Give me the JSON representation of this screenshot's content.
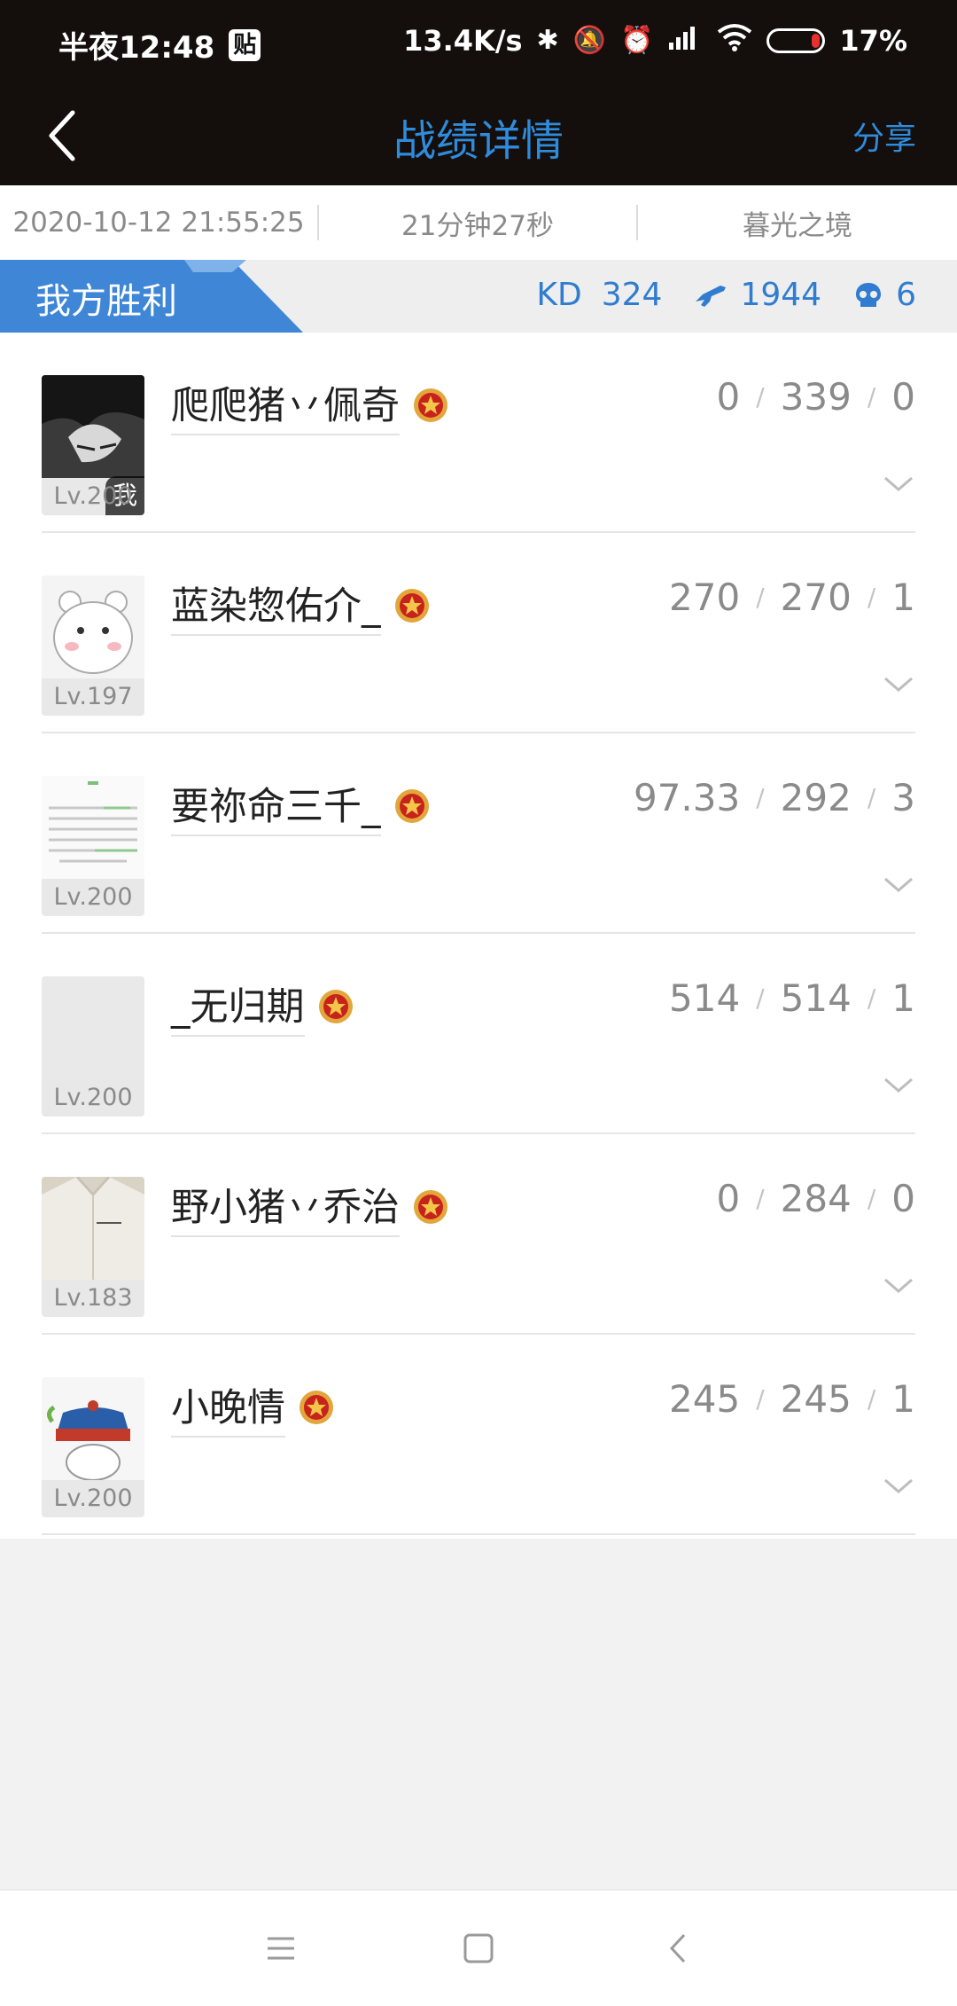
{
  "status_bar": {
    "time": "半夜12:48",
    "tie_badge": "贴",
    "network_speed": "13.4K/s",
    "battery": "17%",
    "battery_level": 0.17
  },
  "nav": {
    "title": "战绩详情",
    "share_label": "分享"
  },
  "match_info": {
    "datetime": "2020-10-12 21:55:25",
    "duration": "21分钟27秒",
    "map": "暮光之境"
  },
  "result": {
    "label": "我方胜利",
    "kd_label": "KD",
    "kd_value": "324",
    "kills": "1944",
    "deaths": "6"
  },
  "players": [
    {
      "name": "爬爬猪丷佩奇",
      "level": "Lv.200",
      "me_tag": "我",
      "stat1": "0",
      "stat2": "339",
      "stat3": "0",
      "avatar": "dark-anime"
    },
    {
      "name": "蓝染惣佑介_",
      "level": "Lv.197",
      "stat1": "270",
      "stat2": "270",
      "stat3": "1",
      "avatar": "cartoon-bear"
    },
    {
      "name": "要祢命三千_",
      "level": "Lv.200",
      "stat1": "97.33",
      "stat2": "292",
      "stat3": "3",
      "avatar": "text-note"
    },
    {
      "name": "_无归期",
      "level": "Lv.200",
      "stat1": "514",
      "stat2": "514",
      "stat3": "1",
      "avatar": "blank"
    },
    {
      "name": "野小猪丷乔治",
      "level": "Lv.183",
      "stat1": "0",
      "stat2": "284",
      "stat3": "0",
      "avatar": "white-shirt"
    },
    {
      "name": "小晚情",
      "level": "Lv.200",
      "stat1": "245",
      "stat2": "245",
      "stat3": "1",
      "avatar": "hat-girl"
    }
  ],
  "colors": {
    "accent": "#2f8cdc",
    "topbar": "#140e0c",
    "victory_flag": "#3f86d6"
  }
}
